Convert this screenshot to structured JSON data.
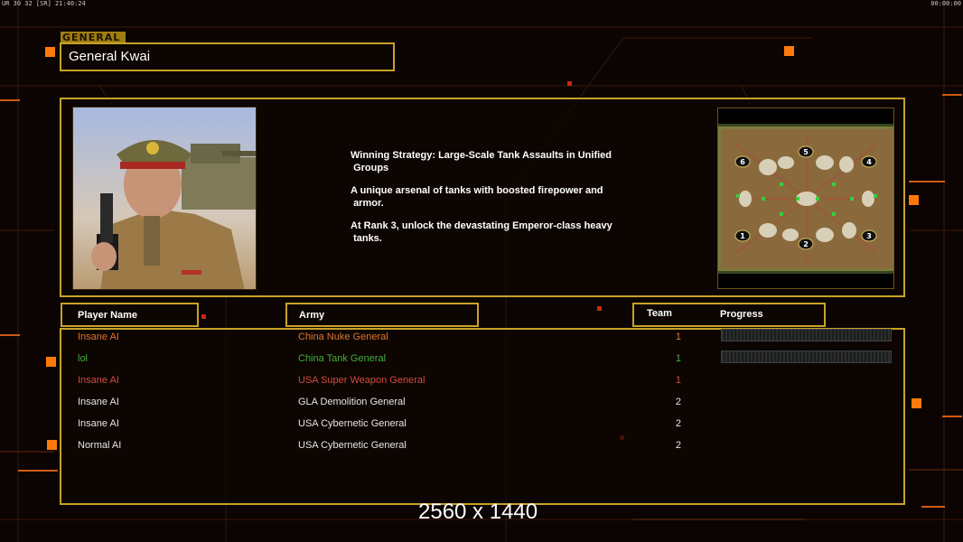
{
  "status": {
    "left": "UR 30 32 [SR] 21:40:24",
    "right": "00:00:00"
  },
  "general": {
    "tag": "GENERAL",
    "name": "General Kwai"
  },
  "description": [
    "Winning Strategy: Large-Scale Tank Assaults in Unified\n Groups",
    "A unique arsenal of tanks with boosted firepower and\n armor.",
    "At Rank 3, unlock the devastating Emperor-class heavy\n tanks."
  ],
  "map": {
    "icon": "skirmish-map-preview",
    "start_positions": [
      "1",
      "2",
      "3",
      "4",
      "5",
      "6"
    ]
  },
  "headers": {
    "player_name": "Player Name",
    "army": "Army",
    "team": "Team",
    "progress": "Progress"
  },
  "players": [
    {
      "name": "Insane AI",
      "army": "China Nuke General",
      "team": "1",
      "color": "#e2762e",
      "progress": 0
    },
    {
      "name": "lol",
      "army": "China Tank General",
      "team": "1",
      "color": "#43b03a",
      "progress": 0
    },
    {
      "name": "Insane AI",
      "army": "USA Super Weapon General",
      "team": "1",
      "color": "#d54b3e"
    },
    {
      "name": "Insane AI",
      "army": "GLA Demolition General",
      "team": "2",
      "color": "#e6e6e6"
    },
    {
      "name": "Insane AI",
      "army": "USA Cybernetic General",
      "team": "2",
      "color": "#e6e6e6"
    },
    {
      "name": "Normal AI",
      "army": "USA Cybernetic General",
      "team": "2",
      "color": "#e6e6e6"
    }
  ],
  "resolution": "2560 x 1440",
  "colors": {
    "frame": "#c8a128",
    "accent": "#ff7a00",
    "background": "#0b0403"
  }
}
